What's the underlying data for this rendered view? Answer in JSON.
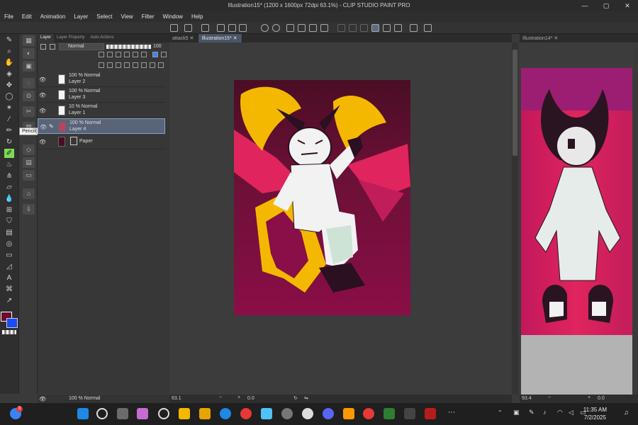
{
  "window": {
    "title": "Illustration15* (1200 x 1600px 72dpi 63.1%) - CLIP STUDIO PAINT PRO",
    "controls": [
      "—",
      "▢",
      "✕"
    ]
  },
  "menu": [
    "File",
    "Edit",
    "Animation",
    "Layer",
    "Select",
    "View",
    "Filter",
    "Window",
    "Help"
  ],
  "tooltip": "Pencil(P)",
  "layer_panel": {
    "tabs": [
      "Layer",
      "Layer Property",
      "Auto Actions"
    ],
    "blend_mode": "Normal",
    "opacity": "100",
    "layers": [
      {
        "mode": "100 % Normal",
        "name": "Layer 2",
        "selected": false
      },
      {
        "mode": "100 % Normal",
        "name": "Layer 3",
        "selected": false
      },
      {
        "mode": "10 % Normal",
        "name": "Layer 1",
        "selected": false
      },
      {
        "mode": "100 % Normal",
        "name": "Layer 4",
        "selected": true
      },
      {
        "mode": "",
        "name": "Paper",
        "selected": false
      }
    ],
    "bottom_layer": "100 % Normal"
  },
  "document_tabs": [
    {
      "name": "attack5",
      "active": false
    },
    {
      "name": "Illustration15*",
      "active": true
    }
  ],
  "second_document": {
    "tab": "Illustration14*",
    "zoom": "93.4",
    "angle": "0.0"
  },
  "status": {
    "zoom": "63.1",
    "angle": "0.0"
  },
  "colors": {
    "main": "#6b0a2e",
    "sub": "#1a4bff",
    "accent": "#596479"
  },
  "taskbar": {
    "notification_count": "3",
    "time": "11:35 AM",
    "date": "7/2/2025"
  }
}
